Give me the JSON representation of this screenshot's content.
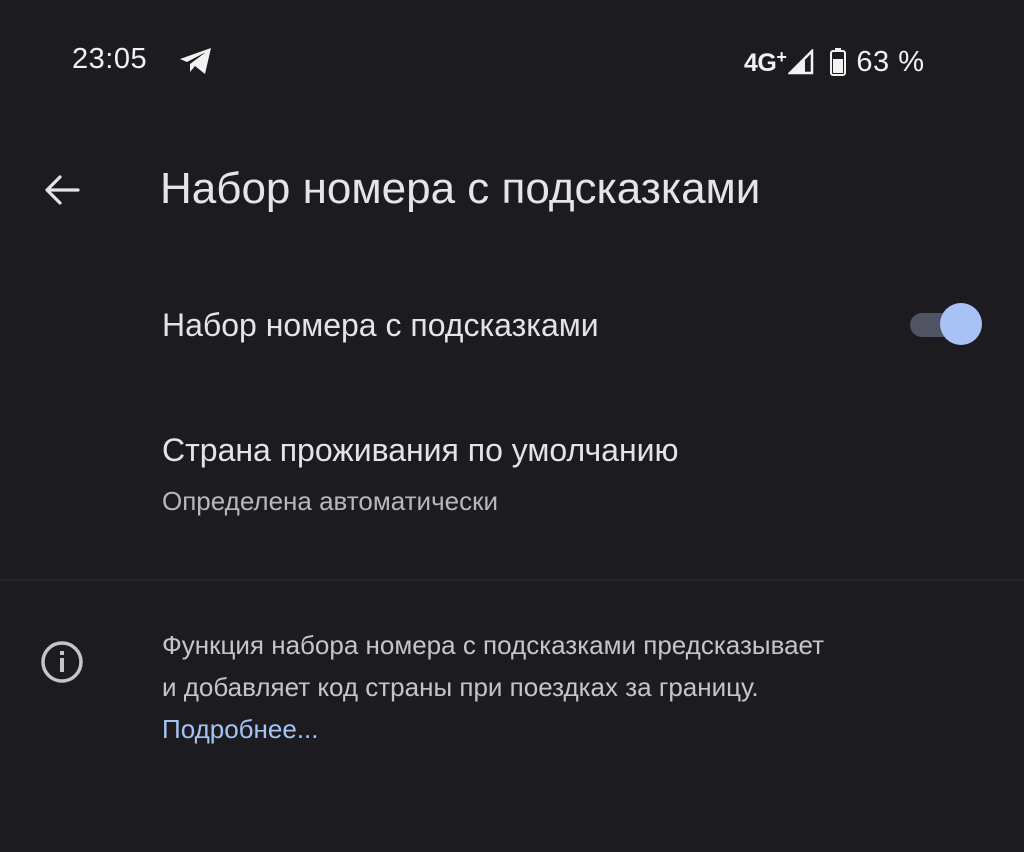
{
  "status_bar": {
    "time": "23:05",
    "network": "4G",
    "network_plus": "+",
    "battery": "63 %",
    "icons": {
      "notification": "telegram-icon",
      "signal": "signal-icon",
      "battery": "battery-icon"
    }
  },
  "app_bar": {
    "back_icon": "arrow-back-icon",
    "title": "Набор номера с подсказками"
  },
  "settings": {
    "assisted_dialing": {
      "label": "Набор номера с подсказками",
      "enabled": true
    },
    "default_country": {
      "label": "Страна проживания по умолчанию",
      "value": "Определена автоматически"
    }
  },
  "info": {
    "icon": "info-icon",
    "line1": "Функция набора номера с подсказками предсказывает",
    "line2": "и добавляет код страны при поездках за границу.",
    "link": "Подробнее..."
  },
  "colors": {
    "background": "#1c1c20",
    "accent": "#a8c2f6",
    "track": "#4f5363",
    "link": "#a5c4f5"
  }
}
